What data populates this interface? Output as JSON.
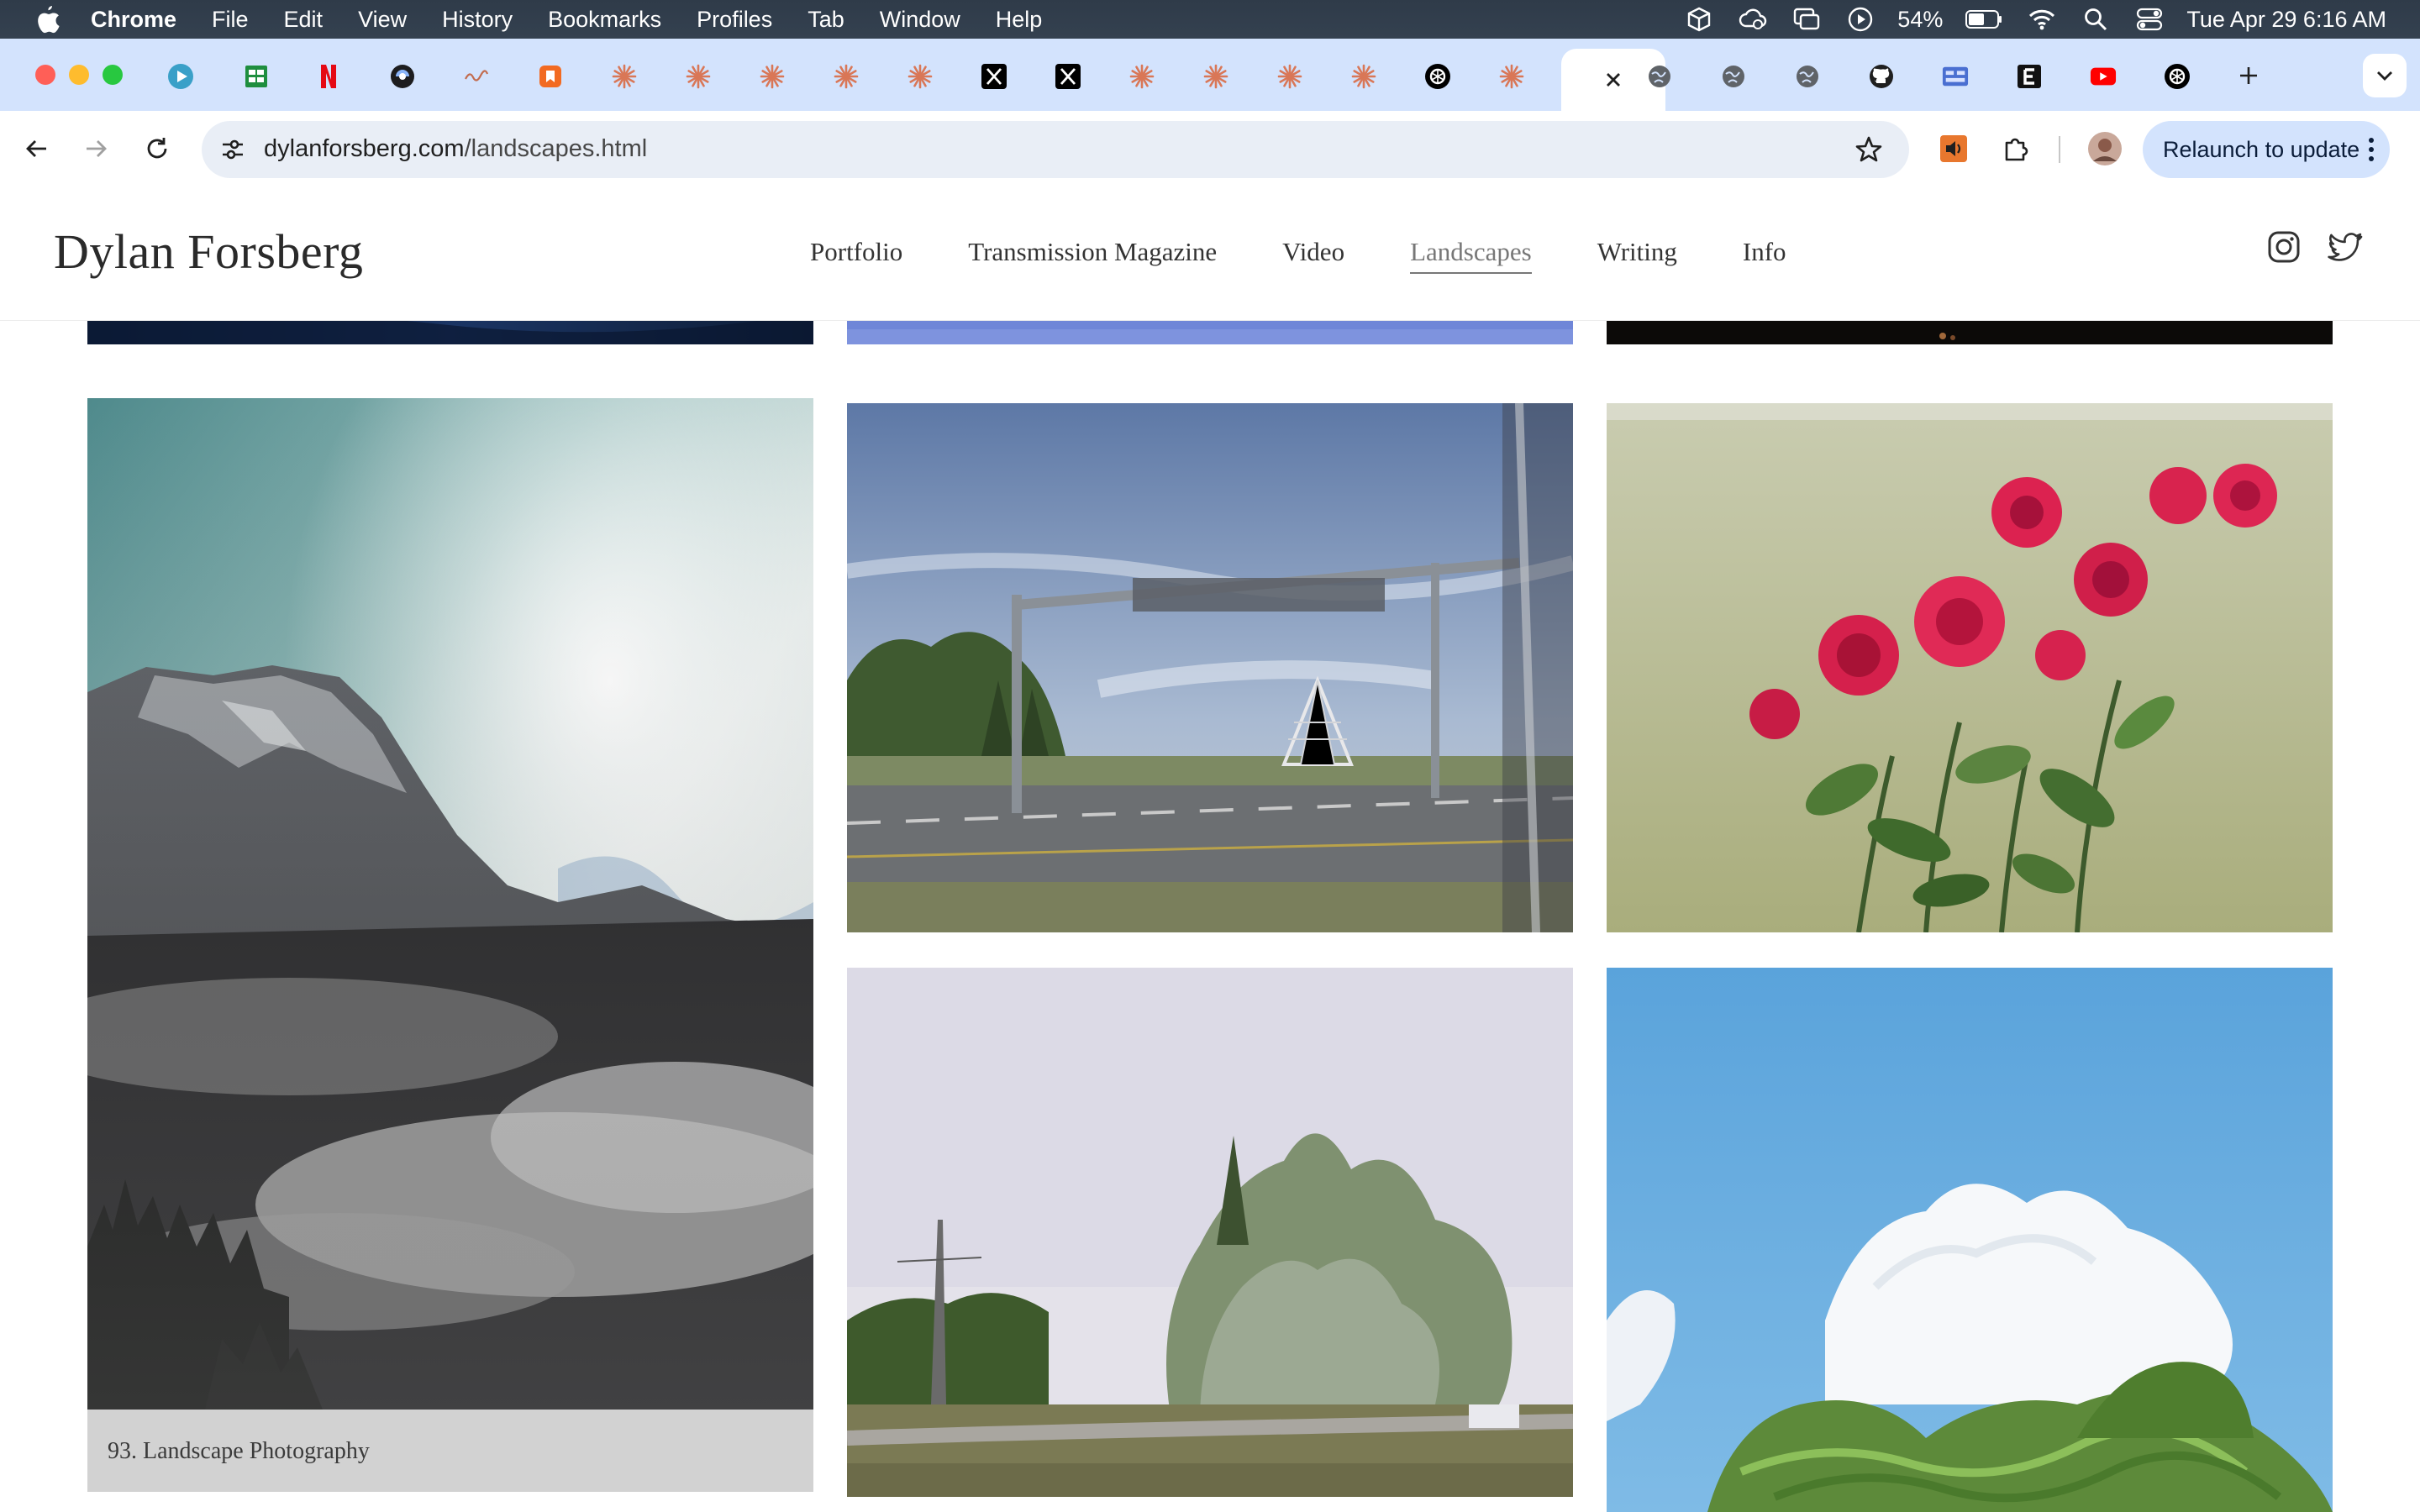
{
  "menubar": {
    "app_name": "Chrome",
    "items": [
      "File",
      "Edit",
      "View",
      "History",
      "Bookmarks",
      "Profiles",
      "Tab",
      "Window",
      "Help"
    ],
    "battery_percent": "54%",
    "datetime": "Tue Apr 29  6:16 AM"
  },
  "tabs": {
    "favicons": [
      "player-icon",
      "sheets-icon",
      "netflix-icon",
      "figma-like-icon",
      "wave-icon",
      "bookmark-app-icon",
      "claude-icon",
      "claude-icon",
      "claude-icon",
      "claude-icon",
      "claude-icon",
      "x-icon",
      "x-icon",
      "claude-icon",
      "claude-icon",
      "claude-icon",
      "claude-icon",
      "openai-icon",
      "claude-icon",
      "close-icon",
      "globe-icon",
      "globe-icon",
      "globe-icon",
      "github-icon",
      "grid-app-icon",
      "e-icon",
      "youtube-icon",
      "openai-icon"
    ],
    "active_index": 19
  },
  "toolbar": {
    "url_domain": "dylanforsberg.com",
    "url_path": "/landscapes.html",
    "relaunch_label": "Relaunch to update"
  },
  "site": {
    "title": "Dylan Forsberg",
    "nav": [
      "Portfolio",
      "Transmission Magazine",
      "Video",
      "Landscapes",
      "Writing",
      "Info"
    ],
    "current_nav": "Landscapes",
    "social": [
      "instagram-icon",
      "twitter-icon"
    ],
    "caption": "93. Landscape Photography"
  },
  "colors": {
    "menubar_bg": "#344150",
    "tabstrip_bg": "#d3e3fd",
    "omnibox_bg": "#e9eef6",
    "relaunch_bg": "#d3e3fd",
    "claude_orange": "#d97757"
  }
}
